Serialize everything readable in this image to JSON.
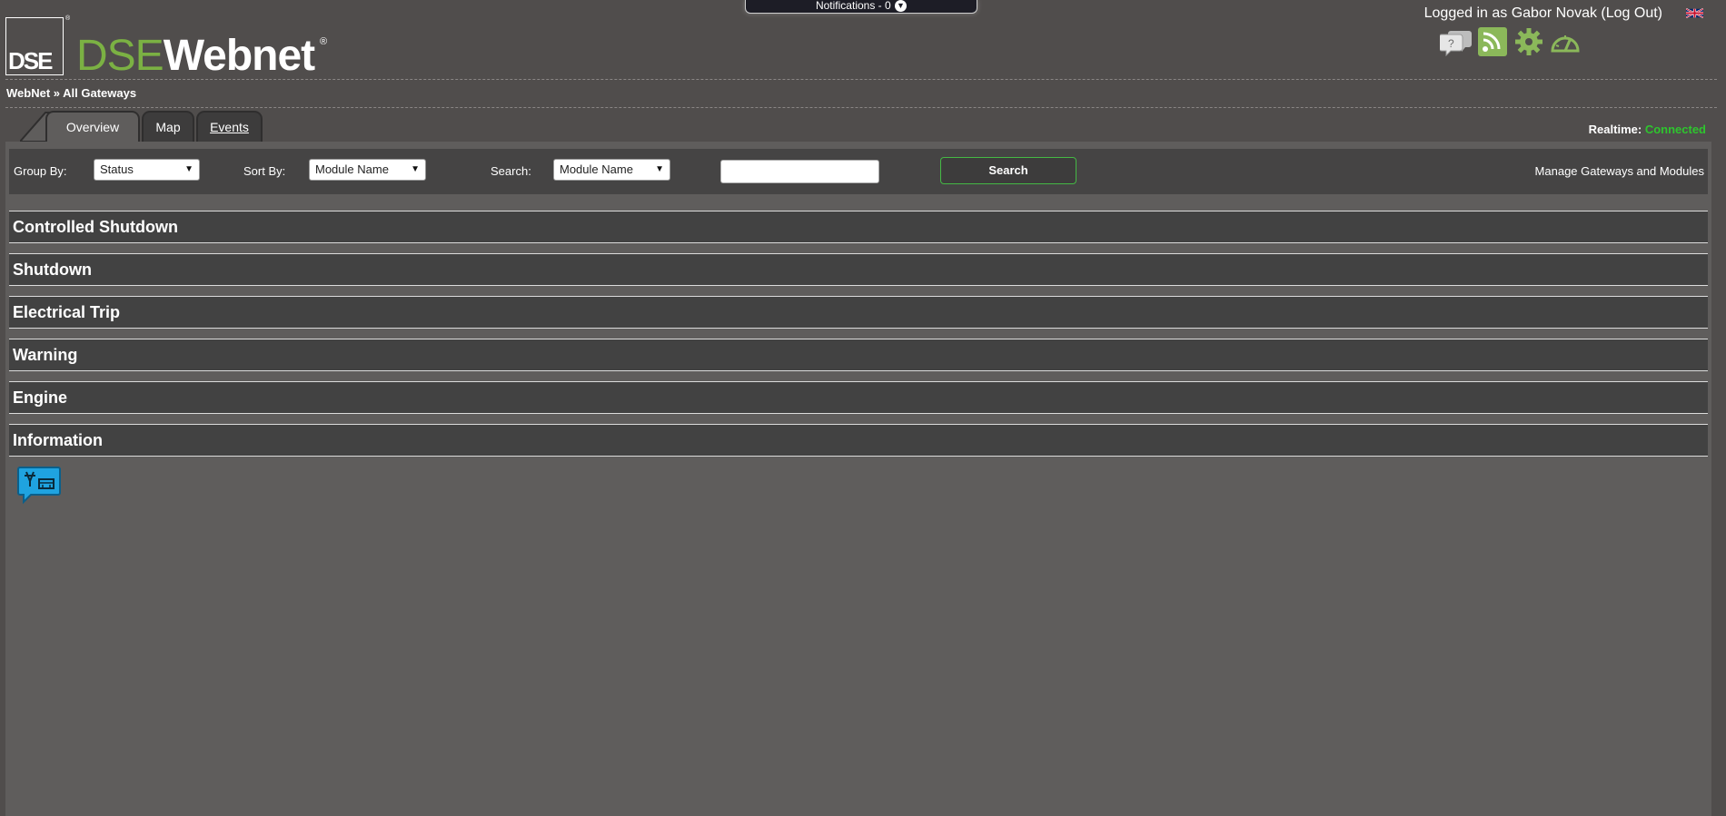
{
  "notification": {
    "label": "Notifications - 0",
    "chevron": "▼"
  },
  "logo": {
    "box_text": "DSE",
    "brand_light": "DSE",
    "brand_bold": "Webnet",
    "reg": "®"
  },
  "user": {
    "line": "Logged in as Gabor Novak (Log Out)",
    "flag_icon": "uk-flag-icon"
  },
  "tool_icons": [
    "help-chat-icon",
    "rss-icon",
    "settings-gear-icon",
    "dashboard-gauge-icon"
  ],
  "breadcrumb": "WebNet » All Gateways",
  "tabs": [
    {
      "label": "Overview",
      "active": true
    },
    {
      "label": "Map",
      "active": false
    },
    {
      "label": "Events",
      "active": false
    }
  ],
  "realtime": {
    "label": "Realtime:",
    "status": "Connected",
    "status_color": "#2ec52e"
  },
  "filters": {
    "group_by_label": "Group By:",
    "group_by_value": "Status",
    "sort_by_label": "Sort By:",
    "sort_by_value": "Module Name",
    "search_label": "Search:",
    "search_field_value": "Module Name",
    "search_text": "",
    "search_button": "Search",
    "manage_link": "Manage Gateways and Modules"
  },
  "groups": [
    "Controlled Shutdown",
    "Shutdown",
    "Electrical Trip",
    "Warning",
    "Engine",
    "Information"
  ],
  "gateway_icon": "gateway-generator-icon"
}
